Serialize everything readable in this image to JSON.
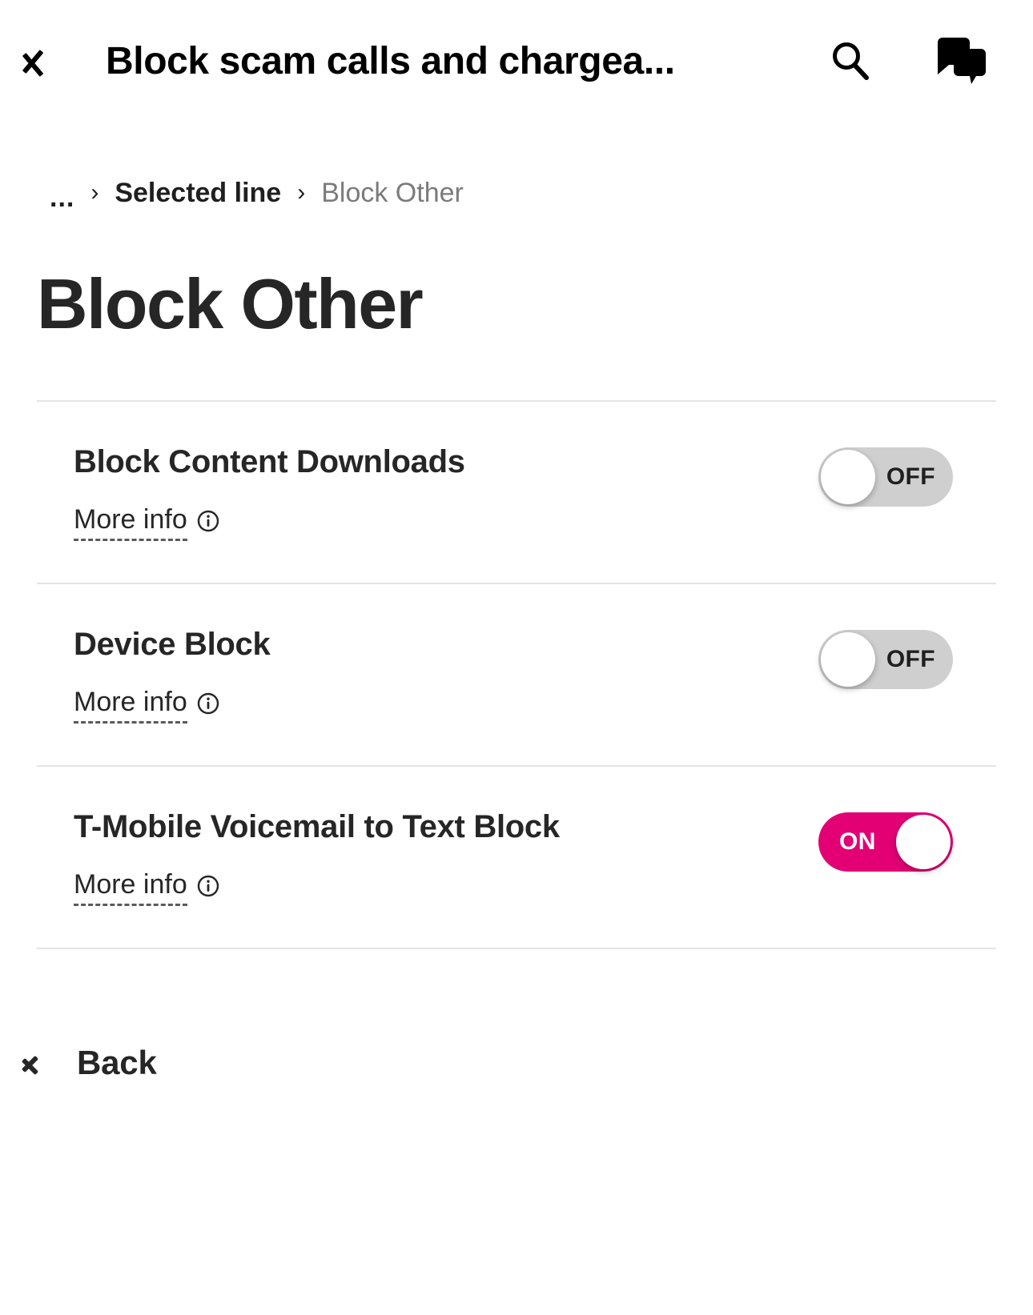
{
  "appbar": {
    "back_icon": "chevron-left-icon",
    "title": "Block scam calls and chargea...",
    "search_icon": "search-icon",
    "chat_icon": "chat-bubbles-icon"
  },
  "breadcrumb": {
    "ellipsis": "...",
    "separator": "›",
    "items": [
      {
        "label": "Selected line",
        "current": false
      },
      {
        "label": "Block Other",
        "current": true
      }
    ]
  },
  "page": {
    "title": "Block Other"
  },
  "settings": {
    "rows": [
      {
        "title": "Block Content Downloads",
        "more_info_label": "More info",
        "info_icon": "info-circle-icon",
        "toggle_state": "off",
        "toggle_label": "OFF"
      },
      {
        "title": "Device Block",
        "more_info_label": "More info",
        "info_icon": "info-circle-icon",
        "toggle_state": "off",
        "toggle_label": "OFF"
      },
      {
        "title": "T-Mobile Voicemail to Text Block",
        "more_info_label": "More info",
        "info_icon": "info-circle-icon",
        "toggle_state": "on",
        "toggle_label": "ON"
      }
    ]
  },
  "footer": {
    "back_icon": "chevron-left-icon",
    "back_label": "Back"
  },
  "colors": {
    "accent_magenta": "#E20074",
    "toggle_off_track": "#CFCFCF",
    "text_primary": "#262626",
    "text_muted": "#7B7B7B",
    "divider": "#E4E4E4"
  }
}
